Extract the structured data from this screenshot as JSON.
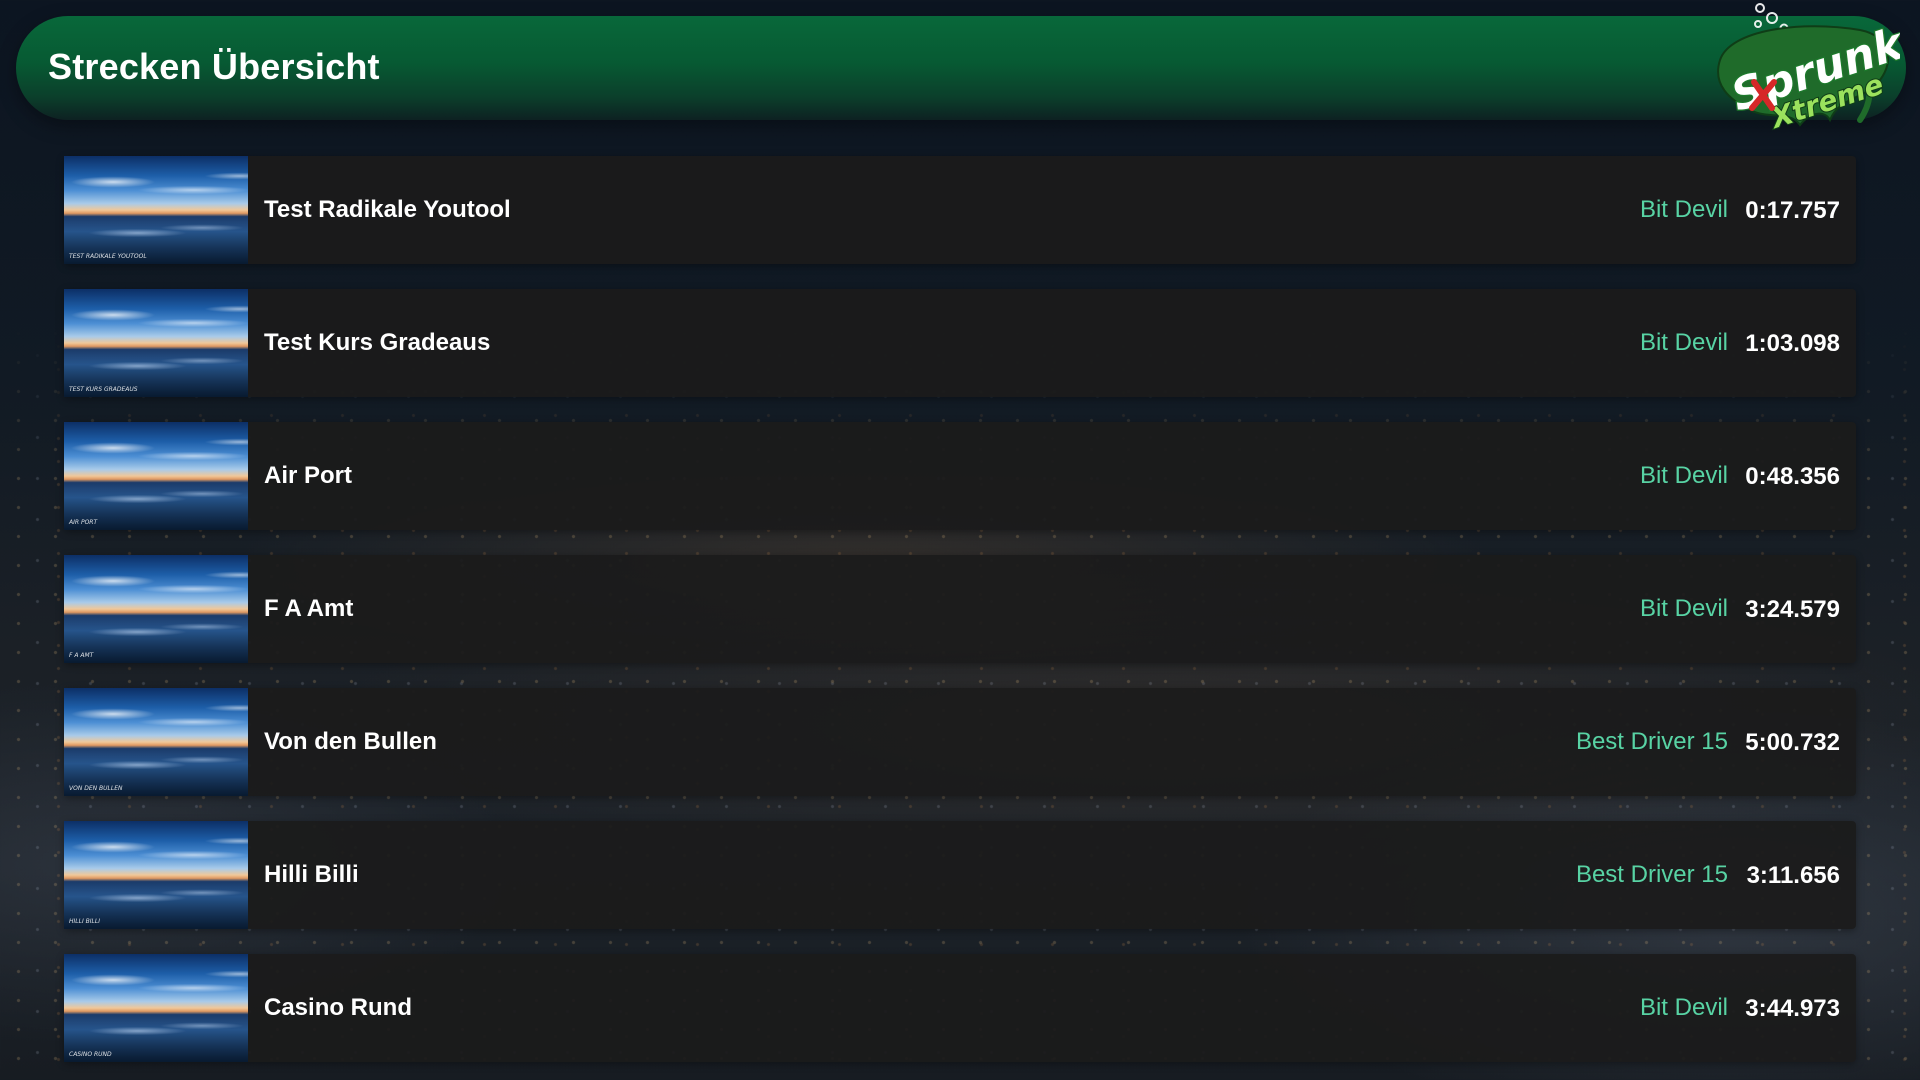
{
  "header": {
    "title": "Strecken Übersicht",
    "logo": {
      "text_main": "Sprunk",
      "text_sub": "Xtreme",
      "icon": "sprunk-xtreme-logo",
      "colors": {
        "green": "#2f9a3a",
        "red": "#d62828",
        "white": "#ffffff"
      }
    }
  },
  "colors": {
    "header_green": "#08683a",
    "row_background": "#1b1b1b",
    "driver_accent": "#58d3a4",
    "text_primary": "#ffffff"
  },
  "tracks": [
    {
      "name": "Test Radikale Youtool",
      "thumb_caption": "Test Radikale Youtool",
      "driver": "Bit Devil",
      "time": "0:17.757"
    },
    {
      "name": "Test Kurs Gradeaus",
      "thumb_caption": "Test Kurs Gradeaus",
      "driver": "Bit Devil",
      "time": "1:03.098"
    },
    {
      "name": "Air Port",
      "thumb_caption": "Air Port",
      "driver": "Bit Devil",
      "time": "0:48.356"
    },
    {
      "name": "F A Amt",
      "thumb_caption": "F A Amt",
      "driver": "Bit Devil",
      "time": "3:24.579"
    },
    {
      "name": "Von den Bullen",
      "thumb_caption": "Von den Bullen",
      "driver": "Best Driver 15",
      "time": "5:00.732"
    },
    {
      "name": "Hilli Billi",
      "thumb_caption": "Hilli Billi",
      "driver": "Best Driver 15",
      "time": "3:11.656"
    },
    {
      "name": "Casino Rund",
      "thumb_caption": "Casino Rund",
      "driver": "Bit Devil",
      "time": "3:44.973"
    }
  ]
}
